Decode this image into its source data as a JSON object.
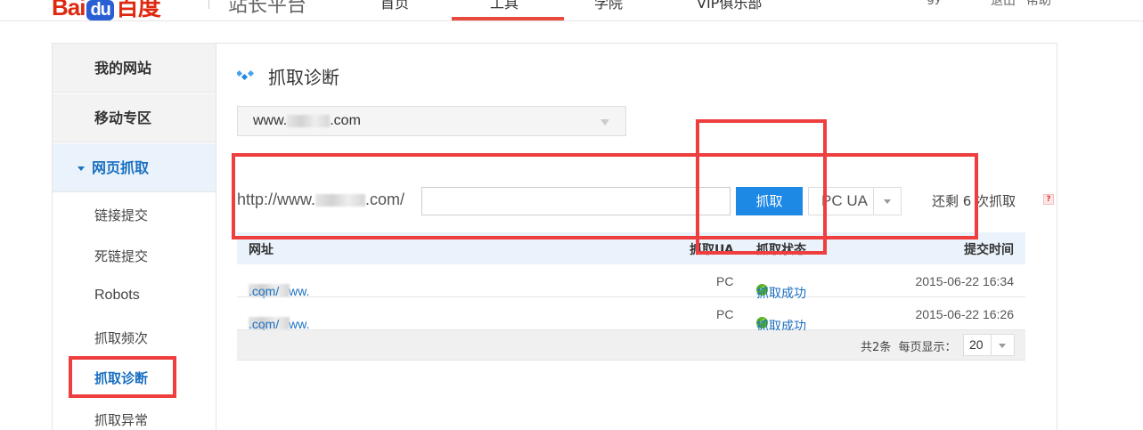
{
  "header": {
    "logo_prefix": "Bai",
    "logo_paw": "du",
    "logo_suffix": "百度",
    "site_name": "站长平台",
    "nav": [
      "首页",
      "工具",
      "学院",
      "VIP俱乐部"
    ],
    "right": [
      "gy",
      "退出",
      "帮助"
    ]
  },
  "sidebar": {
    "categories": [
      "我的网站",
      "移动专区",
      "网页抓取"
    ],
    "items": [
      "链接提交",
      "死链提交",
      "Robots",
      "抓取频次",
      "抓取诊断",
      "抓取异常"
    ],
    "current_item": "抓取诊断"
  },
  "main": {
    "title": "抓取诊断",
    "site_select": {
      "prefix": "www.",
      "suffix": ".com"
    },
    "url_prefix_start": "http://www.",
    "url_prefix_end": ".com/",
    "url_input_value": "",
    "fetch_button": "抓取",
    "ua_select": "PC UA",
    "remaining_text": "还剩 6 次抓取",
    "help_icon": "?"
  },
  "table": {
    "columns": [
      "网址",
      "抓取UA",
      "抓取状态",
      "提交时间"
    ],
    "rows": [
      {
        "url_start": "http://www.",
        "url_end": ".com/",
        "ua": "PC",
        "status": "抓取成功",
        "time": "2015-06-22 16:34"
      },
      {
        "url_start": "http://www.",
        "url_end": ".com/",
        "ua": "PC",
        "status": "抓取成功",
        "time": "2015-06-22 16:26"
      }
    ],
    "footer": {
      "total": "共2条",
      "per_page_label": "每页显示：",
      "per_page": "20"
    }
  },
  "colors": {
    "accent": "#1e88e5",
    "highlight": "#ee3e3e",
    "success": "#5bb41e",
    "link": "#1a6fc1"
  }
}
